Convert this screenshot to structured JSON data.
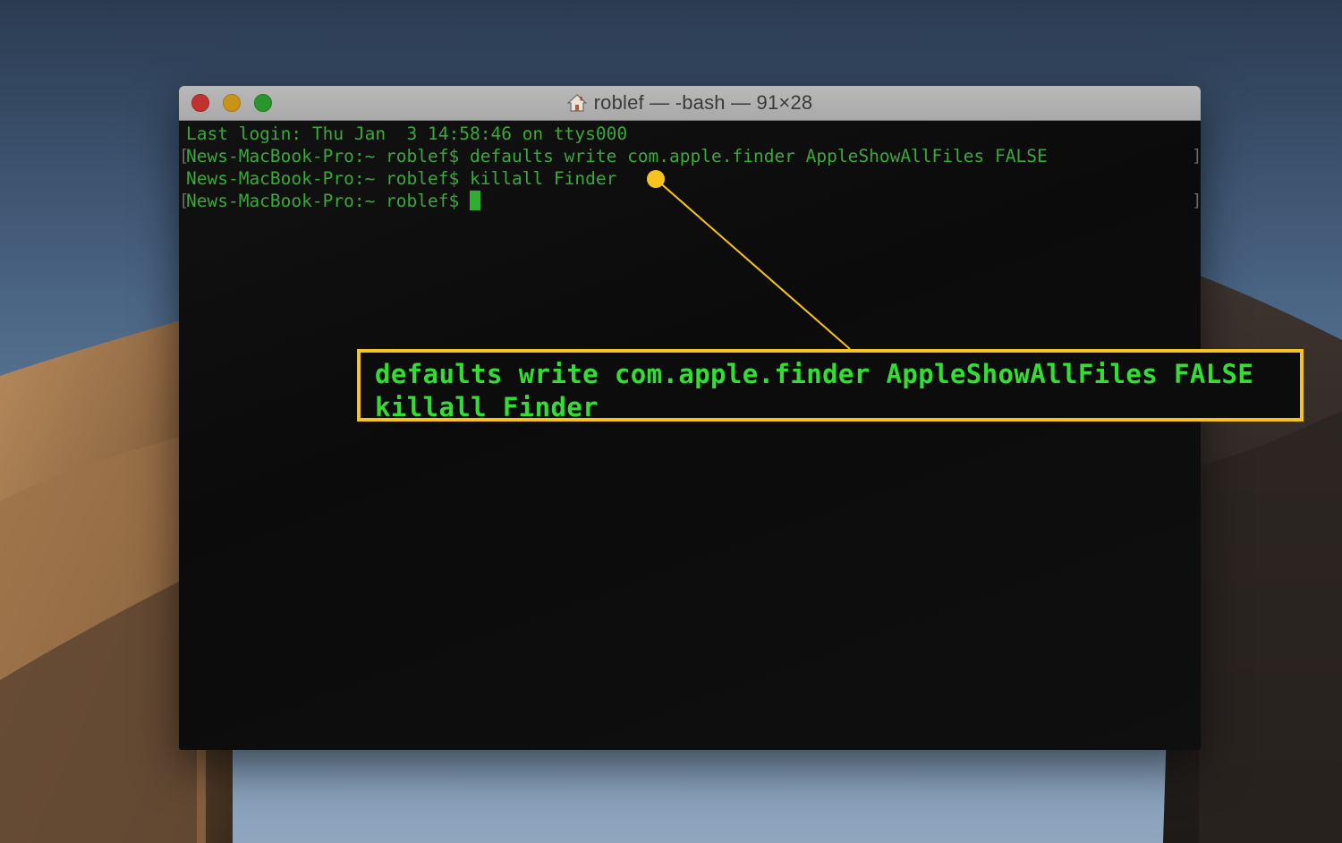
{
  "window": {
    "title": "roblef — -bash — 91×28"
  },
  "terminal": {
    "lines": [
      "Last login: Thu Jan  3 14:58:46 on ttys000",
      "News-MacBook-Pro:~ roblef$ defaults write com.apple.finder AppleShowAllFiles FALSE",
      "News-MacBook-Pro:~ roblef$ killall Finder",
      "News-MacBook-Pro:~ roblef$ "
    ]
  },
  "callout": {
    "lines": [
      "defaults write com.apple.finder AppleShowAllFiles FALSE",
      "killall Finder"
    ]
  },
  "colors": {
    "terminal_text": "#3aa83a",
    "callout_text": "#33dd33",
    "callout_border": "#f6c41c",
    "close": "#c0322b",
    "minimize": "#c9931a",
    "maximize": "#27962b"
  },
  "icons": {
    "title": "home-icon"
  }
}
